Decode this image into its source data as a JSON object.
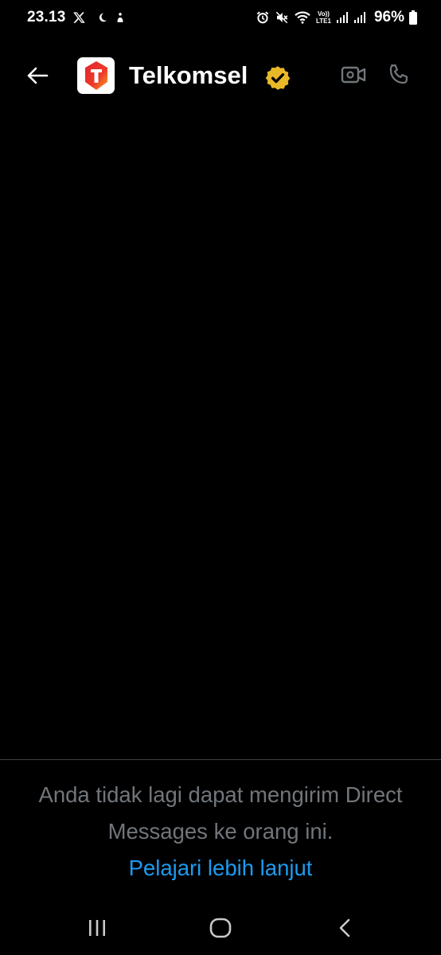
{
  "status_bar": {
    "time": "23.13",
    "left_icons": [
      "x-logo-icon",
      "moon-icon",
      "notification-icon"
    ],
    "right_icons": [
      "alarm-icon",
      "mute-icon",
      "wifi-icon",
      "volte-icon",
      "signal-icon",
      "signal-icon"
    ],
    "volte_label_top": "Vo))",
    "volte_label_bottom": "LTE1",
    "battery_percent": "96%"
  },
  "header": {
    "back_icon": "arrow-left-icon",
    "avatar_icon": "telkomsel-logo-icon",
    "contact_name": "Telkomsel",
    "verified_icon": "verified-badge-icon",
    "video_call_icon": "video-camera-icon",
    "voice_call_icon": "phone-icon"
  },
  "notice": {
    "text": "Anda tidak lagi dapat mengirim Direct Messages ke orang ini.",
    "link_label": "Pelajari lebih lanjut"
  },
  "nav_bar": {
    "recents_icon": "recents-icon",
    "home_icon": "home-icon",
    "back_icon": "nav-back-icon"
  },
  "colors": {
    "background": "#000000",
    "text_primary": "#ffffff",
    "text_secondary": "#71767b",
    "link": "#1d9bf0",
    "divider": "#3e4144",
    "header_icon": "#71767b",
    "verified_gold": "#e8b829",
    "brand_red": "#e3262e"
  }
}
